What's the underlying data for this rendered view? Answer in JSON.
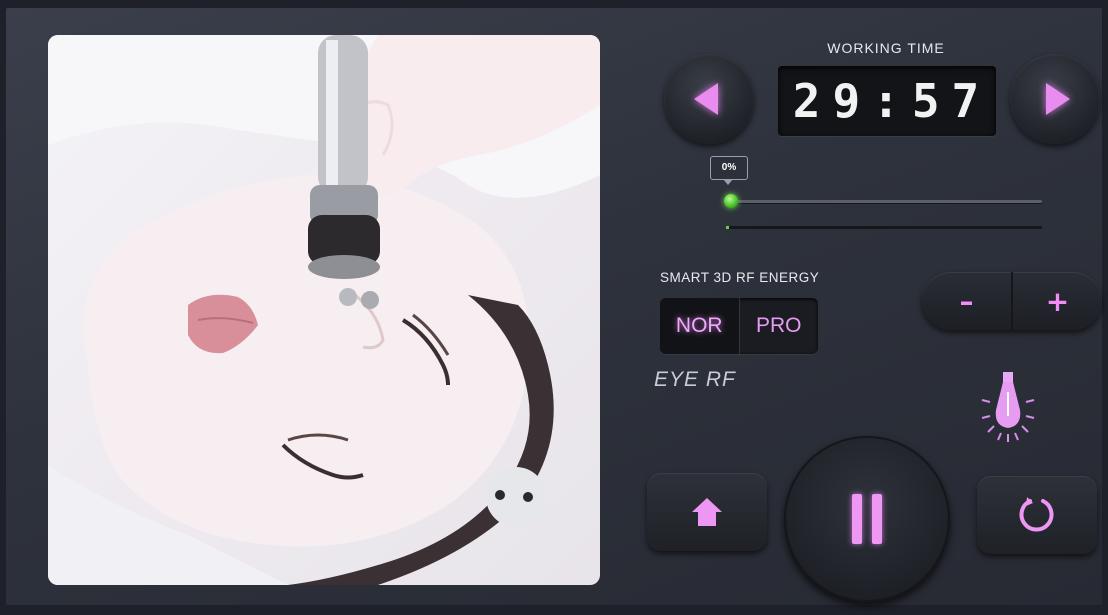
{
  "header": {
    "working_time_label": "WORKING TIME",
    "timer_value": "29:57"
  },
  "intensity": {
    "badge": "0%",
    "level_percent": 0
  },
  "energy": {
    "section_label": "SMART 3D RF ENERGY",
    "modes": [
      {
        "label": "NOR",
        "active": true
      },
      {
        "label": "PRO",
        "active": false
      }
    ],
    "program_name": "EYE RF"
  },
  "adjust": {
    "minus_label": "–",
    "plus_label": "+"
  },
  "icons": {
    "prev": "left-triangle-icon",
    "next": "right-triangle-icon",
    "light": "light-bulb-icon",
    "home": "home-icon",
    "pause": "pause-icon",
    "reset": "reset-icon"
  },
  "colors": {
    "accent": "#e98cf0",
    "indicator": "#6ed44a",
    "background": "#2e323c"
  }
}
